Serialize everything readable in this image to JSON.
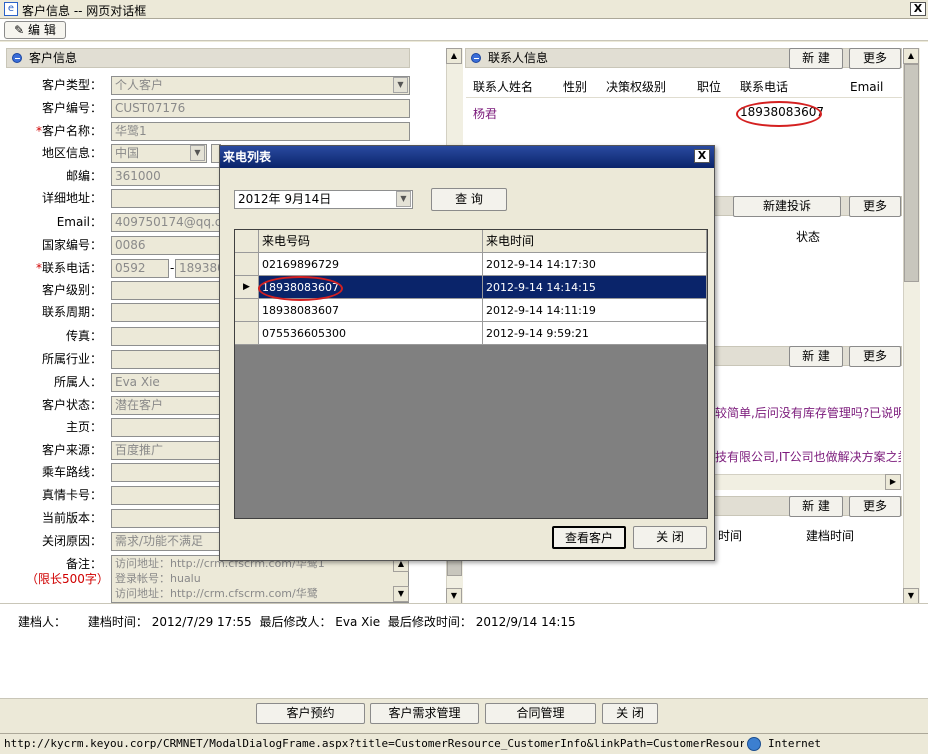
{
  "window": {
    "title": "客户信息 -- 网页对话框",
    "close_glyph": "X"
  },
  "toolbar": {
    "edit_label": "编 辑"
  },
  "customer_section": {
    "title": "客户信息"
  },
  "form": {
    "customer_type": {
      "label": "客户类型：",
      "value": "个人客户"
    },
    "customer_no": {
      "label": "客户编号：",
      "value": "CUST07176"
    },
    "customer_name": {
      "label": "客户名称：",
      "value": "华鹭1",
      "required": "*"
    },
    "region": {
      "label": "地区信息：",
      "country": "中国",
      "value2": ""
    },
    "zip": {
      "label": "邮编：",
      "value": "361000"
    },
    "address": {
      "label": "详细地址：",
      "value": ""
    },
    "email": {
      "label": "Email：",
      "value": "409750174@qq.co"
    },
    "country_code": {
      "label": "国家编号：",
      "value": "0086"
    },
    "phone": {
      "label": "联系电话：",
      "area": "0592",
      "sep": "-",
      "number": "189380",
      "required": "*"
    },
    "level": {
      "label": "客户级别：",
      "value": ""
    },
    "cycle": {
      "label": "联系周期：",
      "value": ""
    },
    "fax": {
      "label": "传真：",
      "value": ""
    },
    "industry": {
      "label": "所属行业：",
      "value": ""
    },
    "owner": {
      "label": "所属人：",
      "value": "Eva Xie"
    },
    "status": {
      "label": "客户状态：",
      "value": "潜在客户"
    },
    "homepage": {
      "label": "主页：",
      "value": ""
    },
    "source": {
      "label": "客户来源：",
      "value": "百度推广"
    },
    "route": {
      "label": "乘车路线：",
      "value": ""
    },
    "card": {
      "label": "真情卡号：",
      "value": ""
    },
    "version": {
      "label": "当前版本：",
      "value": ""
    },
    "close_reason": {
      "label": "关闭原因：",
      "value": "需求/功能不满足"
    },
    "remark": {
      "label": "备注：",
      "limit": "（限长500字）",
      "lines": [
        "访问地址：http://crm.cfscrm.com/华鹭1",
        "登录帐号：hualu",
        "访问地址：http://crm.cfscrm.com/华鹭"
      ]
    }
  },
  "contacts": {
    "title": "联系人信息",
    "new_label": "新 建",
    "more_label": "更多",
    "columns": [
      "联系人姓名",
      "性别",
      "决策权级别",
      "职位",
      "联系电话",
      "Email"
    ],
    "rows": [
      {
        "name": "杨君",
        "gender": "",
        "level": "",
        "position": "",
        "phone": "18938083607",
        "email": ""
      }
    ]
  },
  "complaints": {
    "new_label": "新建投诉",
    "more_label": "更多",
    "status_col": "状态"
  },
  "section3": {
    "new_label": "新 建",
    "more_label": "更多",
    "line1": "较简单,后问没有库存管理吗?已说明",
    "line2": "技有限公司,IT公司也做解决方案之类"
  },
  "section4": {
    "new_label": "新 建",
    "more_label": "更多",
    "col_time": "时间",
    "col_created": "建档时间"
  },
  "footer": {
    "creator_label": "建档人：",
    "created_label": "建档时间：",
    "created_value": "2012/7/29 17:55",
    "modifier_label": "最后修改人：",
    "modifier_value": "Eva Xie",
    "modified_label": "最后修改时间：",
    "modified_value": "2012/9/14 14:15"
  },
  "bottom_buttons": [
    "客户预约",
    "客户需求管理",
    "合同管理",
    "关 闭"
  ],
  "status_bar": {
    "url": "http://kycrm.keyou.corp/CRMNET/ModalDialogFrame.aspx?title=CustomerResource_CustomerInfo&linkPath=CustomerResource/ShowCust",
    "zone": "Internet"
  },
  "dialog": {
    "title": "来电列表",
    "close_glyph": "X",
    "date_value": "2012年  9月14日",
    "query_label": "查 询",
    "columns": [
      "来电号码",
      "来电时间"
    ],
    "rows": [
      {
        "number": "02169896729",
        "time": "2012-9-14  14:17:30"
      },
      {
        "number": "18938083607",
        "time": "2012-9-14  14:14:15"
      },
      {
        "number": "18938083607",
        "time": "2012-9-14  14:11:19"
      },
      {
        "number": "075536605300",
        "time": "2012-9-14  9:59:21"
      }
    ],
    "view_customer_label": "查看客户",
    "close_label": "关 闭"
  }
}
